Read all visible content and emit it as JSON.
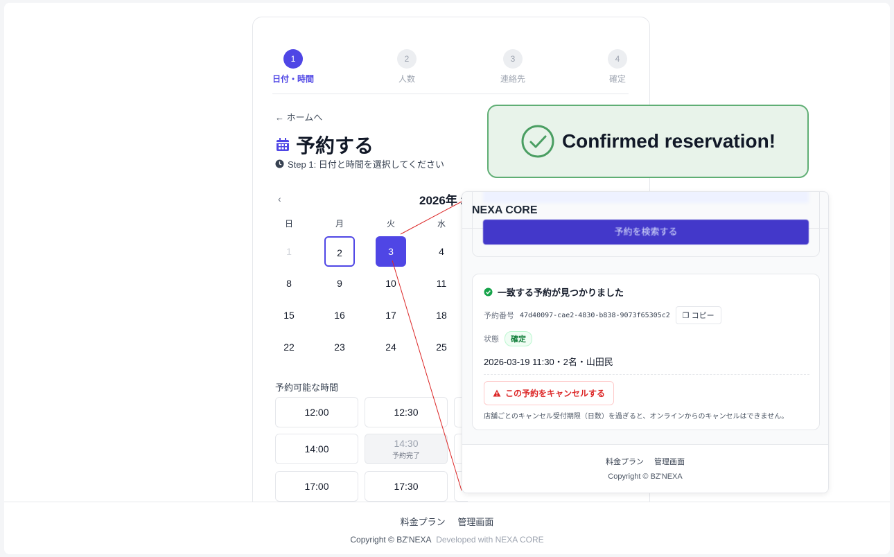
{
  "stepper": {
    "steps": [
      {
        "num": "1",
        "label": "日付・時間"
      },
      {
        "num": "2",
        "label": "人数"
      },
      {
        "num": "3",
        "label": "連絡先"
      },
      {
        "num": "4",
        "label": "確定"
      }
    ],
    "active_step": 1
  },
  "header": {
    "back_label": "ホームへ",
    "title": "予約する",
    "subtitle": "Step 1: 日付と時間を選択してください"
  },
  "calendar": {
    "month_label": "2026年 2",
    "prev_label": "‹",
    "weekdays": [
      "日",
      "月",
      "火",
      "水"
    ],
    "weeks": [
      [
        "1",
        "2",
        "3",
        "4"
      ],
      [
        "8",
        "9",
        "10",
        "11"
      ],
      [
        "15",
        "16",
        "17",
        "18"
      ],
      [
        "22",
        "23",
        "24",
        "25"
      ]
    ],
    "today": "2",
    "selected": "3"
  },
  "slots": {
    "title": "予約可能な時間",
    "items": [
      {
        "time": "12:00",
        "note": "",
        "booked": false
      },
      {
        "time": "12:30",
        "note": "",
        "booked": false
      },
      {
        "time": "14:00",
        "note": "",
        "booked": false
      },
      {
        "time": "14:30",
        "note": "予約完了",
        "booked": true
      },
      {
        "time": "17:00",
        "note": "",
        "booked": false
      },
      {
        "time": "17:30",
        "note": "",
        "booked": false
      }
    ]
  },
  "footer": {
    "link_pricing": "料金プラン",
    "link_admin": "管理画面",
    "copyright": "Copyright © BZ'NEXA",
    "developed": "Developed with NEXA CORE"
  },
  "inset": {
    "brand": "NEXA CORE",
    "search_button": "予約を検索する",
    "result_title": "一致する予約が見つかりました",
    "booking_no_label": "予約番号",
    "booking_no": "47d40097-cae2-4830-b838-9073f65305c2",
    "copy_button": "コピー",
    "status_label": "状態",
    "status_value": "確定",
    "detail": "2026-03-19 11:30・2名・山田民",
    "cancel_button": "この予約をキャンセルする",
    "note": "店舗ごとのキャンセル受付期限（日数）を過ぎると、オンラインからのキャンセルはできません。",
    "footer_pricing": "料金プラン",
    "footer_admin": "管理画面",
    "footer_copy": "Copyright © BZ'NEXA"
  },
  "toast": {
    "message": "Confirmed reservation!"
  },
  "colors": {
    "accent": "#4f46e5",
    "success": "#5fae74",
    "danger": "#dc2626"
  }
}
